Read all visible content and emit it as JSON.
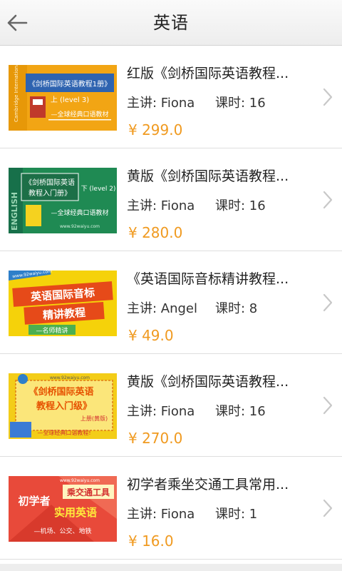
{
  "header": {
    "title": "英语",
    "back_icon": "arrow-left-icon"
  },
  "courses": [
    {
      "name": "红版《剑桥国际英语教程...",
      "teacher": "主讲: Fiona",
      "hours": "课时:   16",
      "price": "¥ 299.0",
      "thumb": {
        "bg": "#f2a514",
        "line1": "《剑桥国际英语教程1册》",
        "line2": "上 (level 3)",
        "line3": "—全球经典口语教材",
        "side": "Cambridge International"
      }
    },
    {
      "name": "黄版《剑桥国际英语教程...",
      "teacher": "主讲: Fiona",
      "hours": "课时:   16",
      "price": "¥ 280.0",
      "thumb": {
        "bg": "#1f8a53",
        "line1": "《剑桥国际英语",
        "line2": "教程入门册》",
        "line3": "下 (level 2)",
        "line4": "—全球经典口语教材",
        "url": "www.92waiyu.com",
        "side": "ENGLISH"
      }
    },
    {
      "name": "《英语国际音标精讲教程...",
      "teacher": "主讲: Angel",
      "hours": "课时:   8",
      "price": "¥ 49.0",
      "thumb": {
        "bg": "#f5d20a",
        "line1": "英语国际音标",
        "line2": "精讲教程",
        "line3": "—名师精讲",
        "url": "www.92waiyu.com"
      }
    },
    {
      "name": "黄版《剑桥国际英语教程...",
      "teacher": "主讲: Fiona",
      "hours": "课时:   16",
      "price": "¥ 270.0",
      "thumb": {
        "bg": "#f3cd18",
        "line1": "《剑桥国际英语",
        "line2": "教程入门级》",
        "line3": "上册(黄版)",
        "line4": "—全球经典口语教程!",
        "url": "www.92waiyu.com"
      }
    },
    {
      "name": "初学者乘坐交通工具常用...",
      "teacher": "主讲: Fiona",
      "hours": "课时:   1",
      "price": "¥ 16.0",
      "thumb": {
        "bg": "#e84a3a",
        "line1": "乘交通工具",
        "line2": "初学者",
        "line3": "实用英语",
        "line4": "—机场、公交、地铁",
        "url": "www.92waiyu.com"
      }
    }
  ]
}
